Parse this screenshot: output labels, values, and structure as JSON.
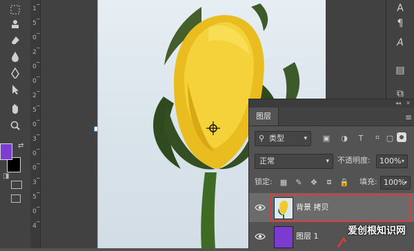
{
  "toolbar": {
    "tools": [
      {
        "name": "marquee-tool-icon",
        "glyph": "⬚"
      },
      {
        "name": "clone-stamp-tool-icon",
        "glyph": "♙"
      },
      {
        "name": "eraser-tool-icon",
        "glyph": "⌫"
      },
      {
        "name": "blur-tool-icon",
        "glyph": "💧"
      },
      {
        "name": "pen-tool-icon",
        "glyph": "✒"
      },
      {
        "name": "path-selection-tool-icon",
        "glyph": "➤"
      },
      {
        "name": "hand-tool-icon",
        "glyph": "✋"
      },
      {
        "name": "zoom-tool-icon",
        "glyph": "🔍"
      }
    ],
    "foreground_color": "#7c3ed1",
    "background_color": "#000000"
  },
  "ruler": {
    "labels": [
      "1",
      "5",
      "0",
      "2",
      "0",
      "0",
      "2",
      "5",
      "0",
      "3",
      "0",
      "0",
      "3",
      "5",
      "0",
      "4"
    ]
  },
  "right_strip": {
    "buttons": [
      {
        "name": "character-panel-icon",
        "glyph": "A"
      },
      {
        "name": "paragraph-panel-icon",
        "glyph": "¶"
      },
      {
        "name": "glyphs-panel-icon",
        "glyph": "𝒜"
      },
      {
        "name": "properties-panel-icon",
        "glyph": "▤"
      },
      {
        "name": "adjustments-panel-icon",
        "glyph": "⧉"
      }
    ]
  },
  "layers_panel": {
    "tab_label": "图层",
    "filter": {
      "label": "类型"
    },
    "blend_mode": "正常",
    "opacity_label": "不透明度:",
    "opacity_value": "100%",
    "lock_label": "锁定:",
    "fill_label": "填充:",
    "fill_value": "100%",
    "layers": [
      {
        "name": "背景 拷贝",
        "selected": true
      },
      {
        "name": "图层 1",
        "selected": false
      }
    ]
  },
  "watermark": {
    "text": "爱创根知识网"
  },
  "colors": {
    "accent_red": "#e23a3a",
    "rose_yellow": "#f0c92a",
    "leaf_green": "#3f5a2a"
  }
}
